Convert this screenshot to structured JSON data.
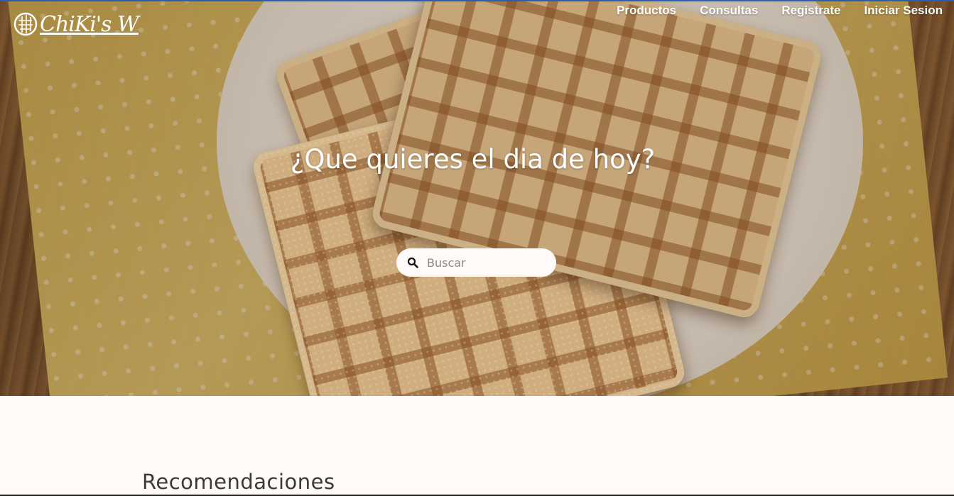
{
  "brand": {
    "name": "ChiKi's W"
  },
  "nav": {
    "items": [
      {
        "label": "Productos"
      },
      {
        "label": "Consultas"
      },
      {
        "label": "Registrate"
      },
      {
        "label": "Iniciar Sesion"
      }
    ]
  },
  "hero": {
    "headline": "¿Que quieres el dia de hoy?",
    "search": {
      "placeholder": "Buscar",
      "value": "",
      "icon": "search-icon"
    }
  },
  "sections": {
    "recommendations_title": "Recomendaciones"
  },
  "colors": {
    "accent_line": "#2a5fb0",
    "page_background": "#fff9f8",
    "text_white": "#ffffff"
  }
}
